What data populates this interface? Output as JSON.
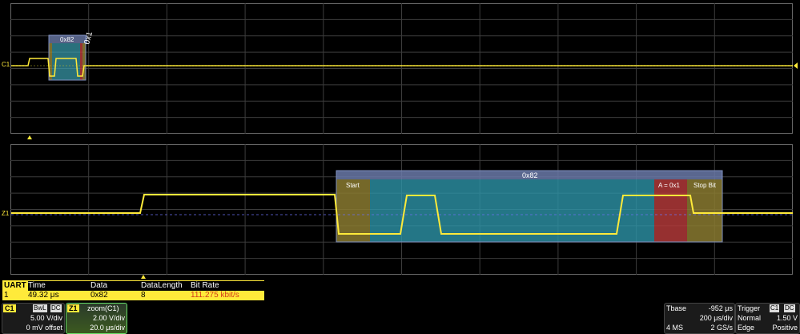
{
  "markers": {
    "channel": "C1",
    "zoom": "Z1"
  },
  "decode": {
    "top_label": "0x82",
    "top_rot_label": "0x1",
    "zoom_label": "0x82",
    "start": "Start",
    "parity": "A = 0x1",
    "stop": "Stop Bit"
  },
  "table": {
    "tag": "UART",
    "headers": [
      "Time",
      "Data",
      "DataLength",
      "Bit Rate"
    ],
    "row": {
      "index": "1",
      "time": "49.32 μs",
      "data": "0x82",
      "length": "8",
      "bitrate": "111.275 kbit/s"
    }
  },
  "c1_box": {
    "label": "C1",
    "bwl": "BwL",
    "dc": "DC",
    "vdiv": "5.00 V/div",
    "offset": "0 mV offset"
  },
  "z1_box": {
    "label": "Z1",
    "title": "zoom(C1)",
    "vdiv": "2.00 V/div",
    "tdiv": "20.0 μs/div"
  },
  "tbase_box": {
    "label": "Tbase",
    "value": "-952 μs",
    "tdiv": "200 μs/div",
    "ms": "4 MS",
    "rate": "2 GS/s"
  },
  "trigger_box": {
    "label": "Trigger",
    "ch": "C1",
    "dc": "DC",
    "mode": "Normal",
    "level": "1.50 V",
    "type": "Edge",
    "slope": "Positive"
  },
  "colors": {
    "trace": "#ffea3a",
    "accent": "#ffea3a"
  }
}
